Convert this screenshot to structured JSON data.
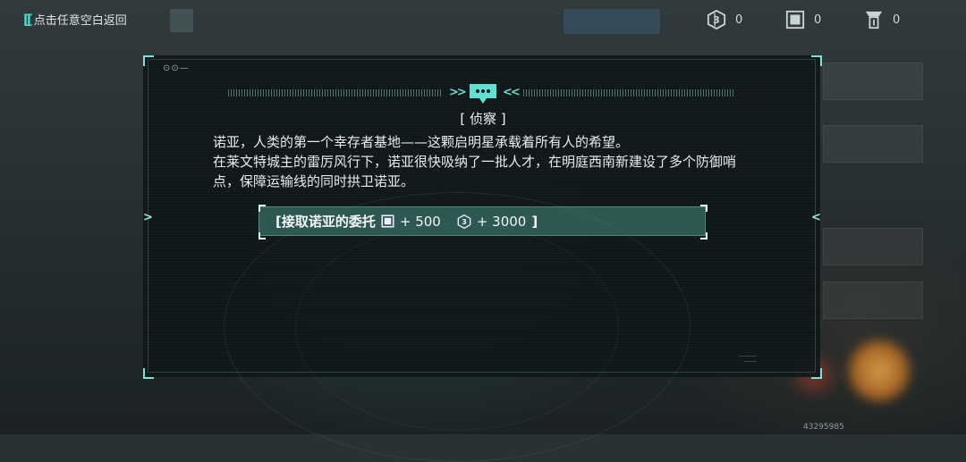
{
  "header": {
    "back_label": "点击任意空白返回",
    "currencies": [
      {
        "icon": "coin-icon",
        "value": "0"
      },
      {
        "icon": "chip-icon",
        "value": "0"
      },
      {
        "icon": "badge-icon",
        "value": "0"
      }
    ]
  },
  "dialog": {
    "corner_dots": "⊙⊙—",
    "title": "[ 侦察 ]",
    "paragraphs": [
      "诺亚，人类的第一个幸存者基地——这颗启明星承载着所有人的希望。",
      "在莱文特城主的雷厉风行下，诺亚很快吸纳了一批人才，在明庭西南新建设了多个防御哨点，保障运输线的同时拱卫诺亚。"
    ],
    "accept_button": {
      "label": "[接取诺亚的委托",
      "reward_chip": "+ 500",
      "reward_coin": "+ 3000",
      "close_bracket": "]"
    },
    "serial_lines": [
      "‑‑‑‑‑‑‑‑‑‑‑",
      "‑‑‑‑‑‑‑‑"
    ]
  },
  "footer": {
    "uid": "43295985"
  },
  "colors": {
    "accent": "#46d8c8",
    "dialog_bg": "#0e1618",
    "button_bg": "#468c82"
  }
}
